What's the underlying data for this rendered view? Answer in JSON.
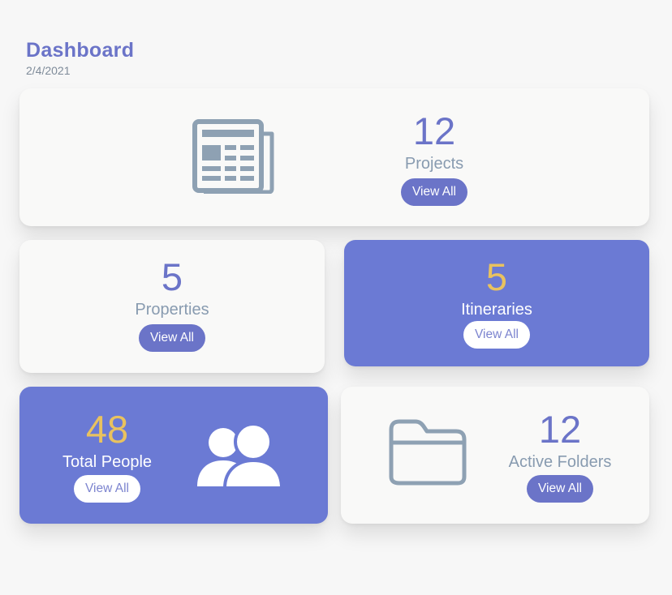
{
  "header": {
    "title": "Dashboard",
    "date": "2/4/2021"
  },
  "cards": {
    "projects": {
      "count": "12",
      "label": "Projects",
      "button": "View All",
      "icon": "newspaper-icon"
    },
    "properties": {
      "count": "5",
      "label": "Properties",
      "button": "View All"
    },
    "itineraries": {
      "count": "5",
      "label": "Itineraries",
      "button": "View All"
    },
    "people": {
      "count": "48",
      "label": "Total People",
      "button": "View All",
      "icon": "people-icon"
    },
    "folders": {
      "count": "12",
      "label": "Active Folders",
      "button": "View All",
      "icon": "folder-icon"
    }
  },
  "colors": {
    "accent": "#6b74c8",
    "card_purple": "#6b7ad4",
    "highlight": "#e9c25f",
    "icon_grey": "#8ea1b3"
  }
}
